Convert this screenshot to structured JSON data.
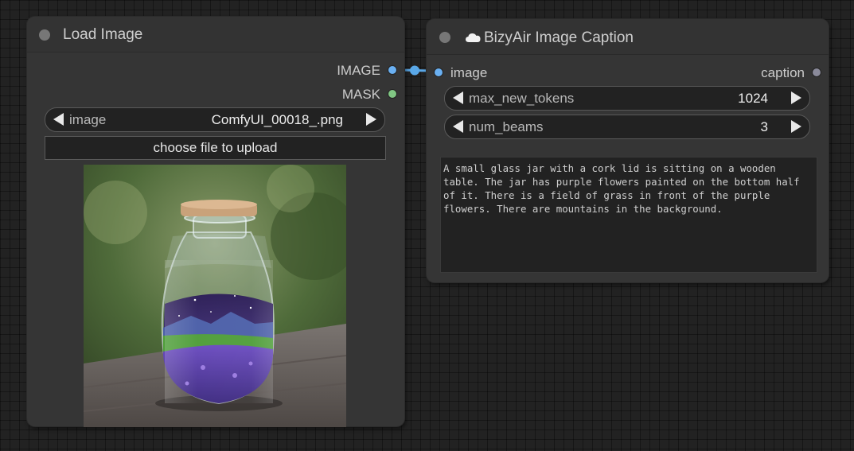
{
  "load_image_node": {
    "title": "Load Image",
    "outputs": [
      {
        "label": "IMAGE",
        "color": "#6ab0f2"
      },
      {
        "label": "MASK",
        "color": "#81c784"
      }
    ],
    "image_widget": {
      "name": "image",
      "value": "ComfyUI_00018_.png"
    },
    "upload_button_label": "choose file to upload",
    "preview_icon": "glass-jar-with-purple-flowers-image"
  },
  "caption_node": {
    "title": "BizyAir Image Caption",
    "title_icon": "cloud-icon",
    "input": {
      "label": "image",
      "color": "#6ab0f2"
    },
    "output": {
      "label": "caption",
      "color": "#8a8a9a"
    },
    "widgets": [
      {
        "name": "max_new_tokens",
        "value": "1024"
      },
      {
        "name": "num_beams",
        "value": "3"
      }
    ],
    "caption_text": "A small glass jar with a cork lid is sitting on a wooden table. The jar has purple flowers painted on the bottom half of it. There is a field of grass in front of the purple flowers. There are mountains in the background."
  },
  "colors": {
    "canvas": "#222222",
    "node_body": "#353535",
    "link": "#5aa8e8"
  }
}
